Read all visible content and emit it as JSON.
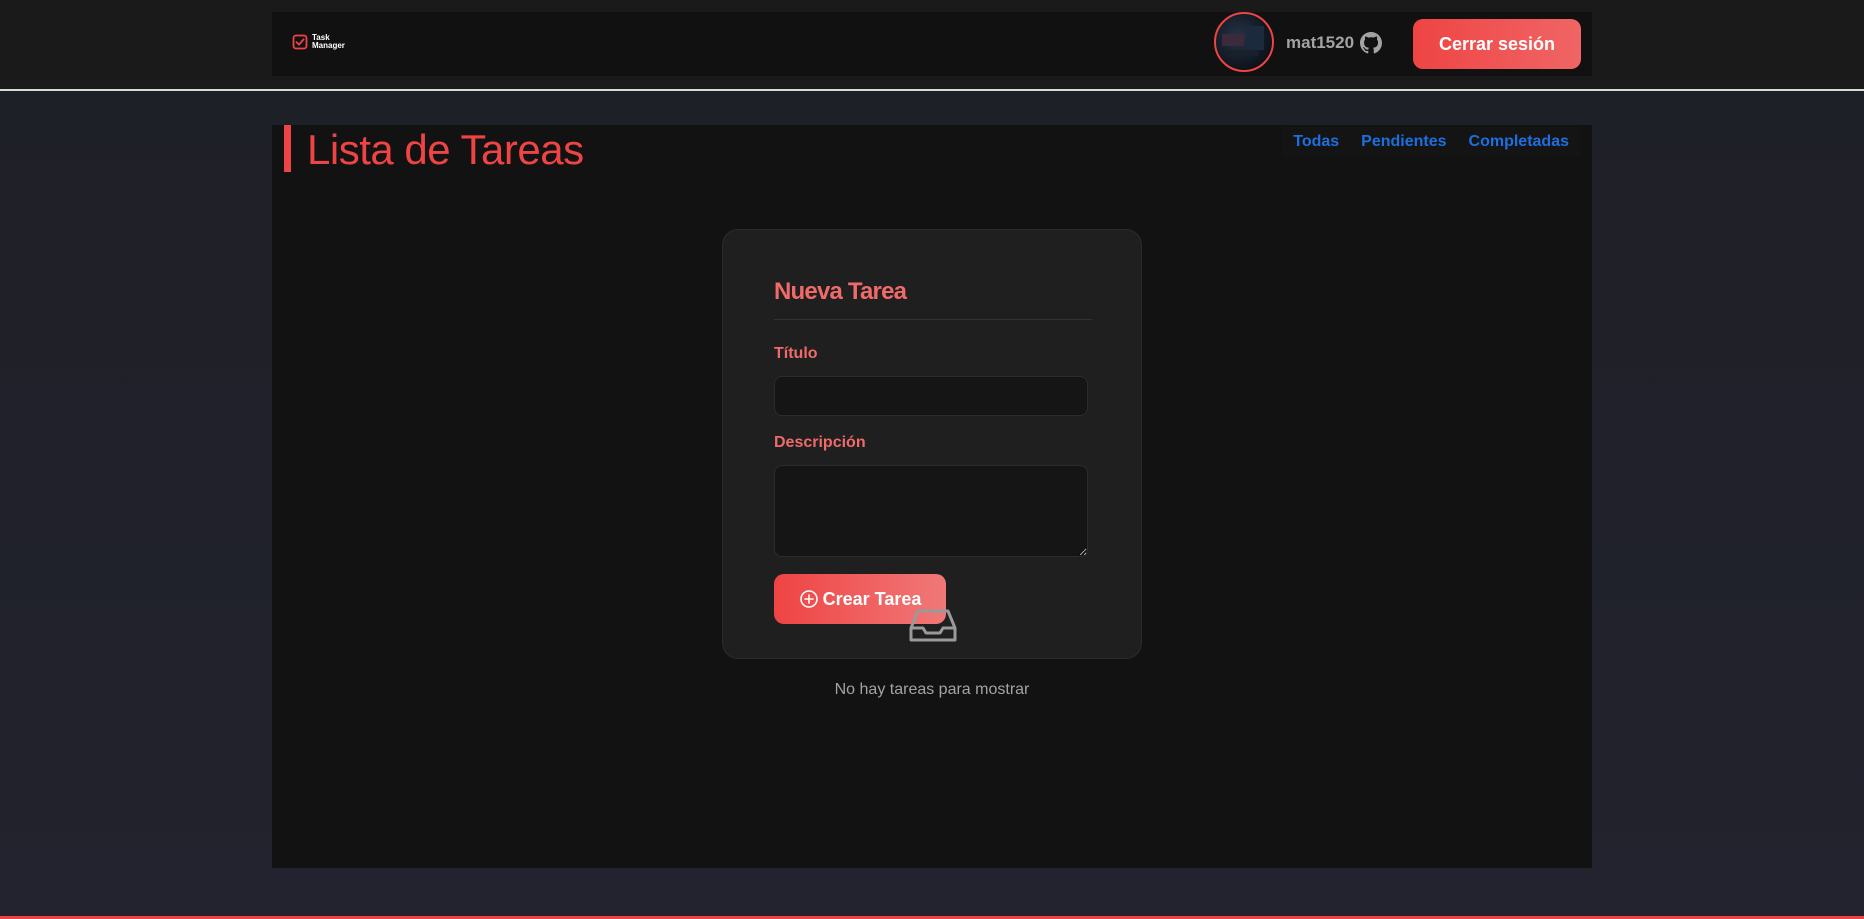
{
  "header": {
    "logo_line1": "Task",
    "logo_line2": "Manager",
    "logo_icon": "checkbox-icon",
    "username": "mat1520",
    "github_icon": "github-icon",
    "logout_label": "Cerrar sesión"
  },
  "main": {
    "title": "Lista de Tareas",
    "filters": [
      "Todas",
      "Pendientes",
      "Completadas"
    ]
  },
  "form": {
    "heading": "Nueva Tarea",
    "title_label": "Título",
    "title_value": "",
    "description_label": "Descripción",
    "description_value": "",
    "submit_label": "Crear Tarea",
    "submit_icon": "plus-circle-icon"
  },
  "empty_state": {
    "icon": "inbox-icon",
    "message": "No hay tareas para mostrar"
  },
  "colors": {
    "accent": "#ef4444",
    "link": "#1d6fe0",
    "panel": "#121212",
    "card": "#1f1f1f"
  }
}
